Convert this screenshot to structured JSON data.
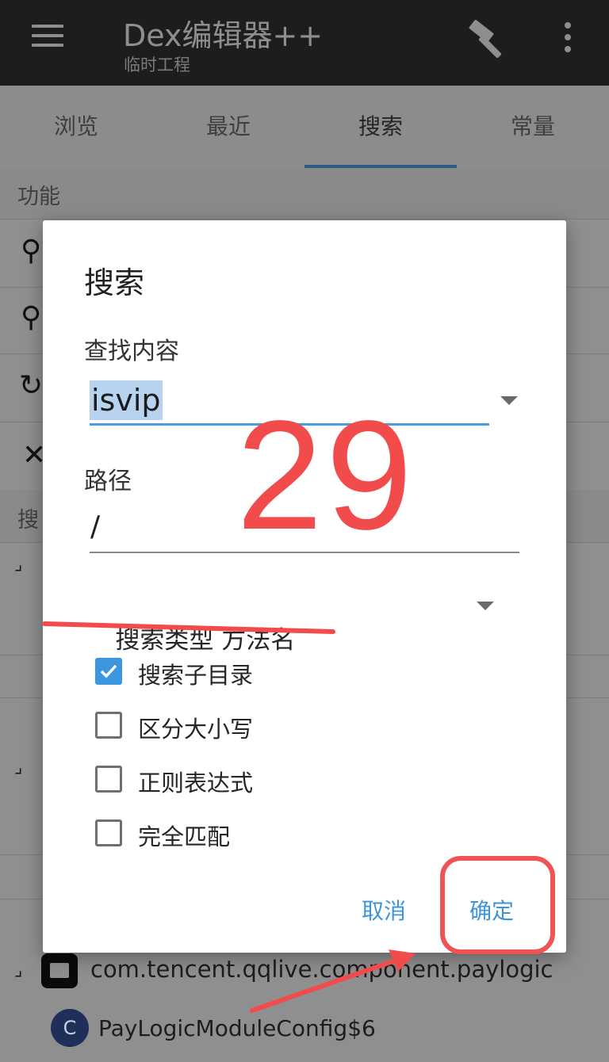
{
  "app": {
    "title": "Dex编辑器++",
    "subtitle": "临时工程",
    "icons": [
      "menu-icon",
      "hammer-icon",
      "more-vert-icon"
    ]
  },
  "tabs": [
    {
      "label": "浏览",
      "active": false
    },
    {
      "label": "最近",
      "active": false
    },
    {
      "label": "搜索",
      "active": true
    },
    {
      "label": "常量",
      "active": false
    }
  ],
  "background": {
    "section_function": "功能",
    "section_search": "搜",
    "package_name": "com.tencent.qqlive.component.paylogic",
    "class_badge": "C",
    "class_name": "PayLogicModuleConfig$6"
  },
  "dialog": {
    "title": "搜索",
    "find_label": "查找内容",
    "find_value": "isvip",
    "path_label": "路径",
    "path_value": "/",
    "search_type_label": "搜索类型",
    "search_type_value": "方法名",
    "checkboxes": [
      {
        "label": "搜索子目录",
        "checked": true
      },
      {
        "label": "区分大小写",
        "checked": false
      },
      {
        "label": "正则表达式",
        "checked": false
      },
      {
        "label": "完全匹配",
        "checked": false
      }
    ],
    "cancel_label": "取消",
    "confirm_label": "确定"
  },
  "annotation": {
    "step_number": "29",
    "color": "#f24b4b"
  },
  "colors": {
    "accent": "#3c97de",
    "appbar": "#1d1d1d",
    "highlight": "#b7d3f0"
  }
}
